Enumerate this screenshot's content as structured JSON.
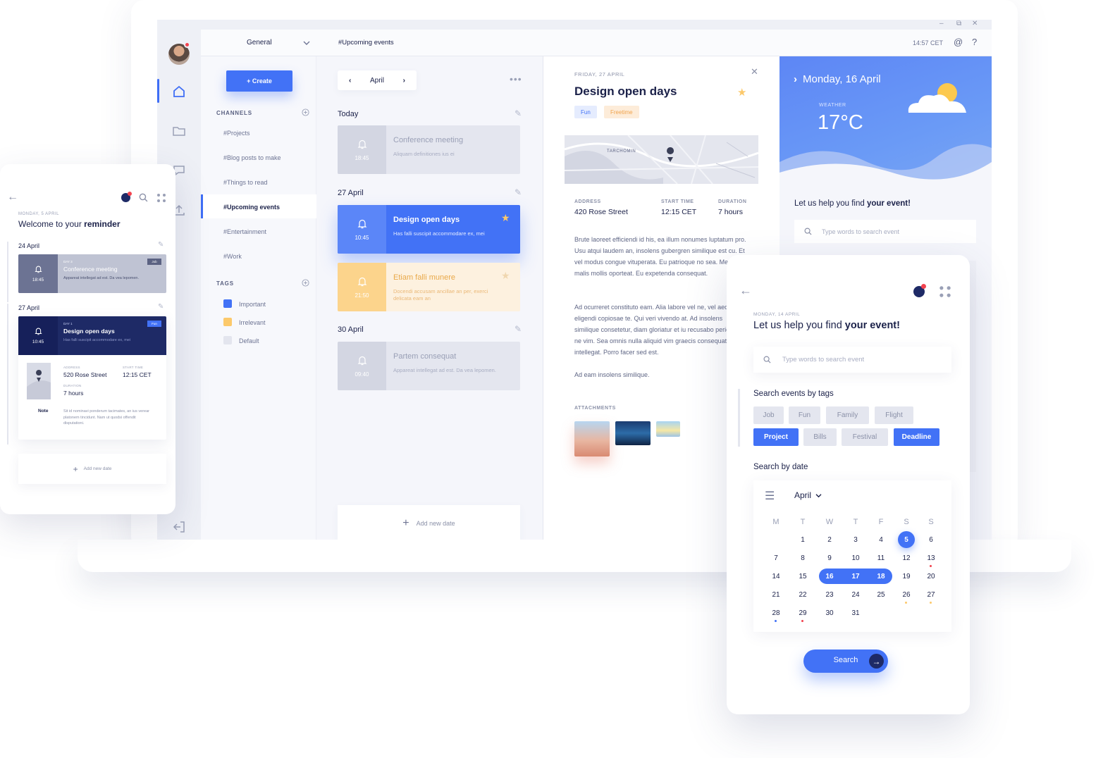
{
  "window": {
    "min": "–",
    "restore": "⧉",
    "close": "✕",
    "clock": "14:57 CET",
    "at": "@",
    "help": "?"
  },
  "sidebar": {
    "workspace": "General",
    "create_label": "+ Create",
    "channels_title": "CHANNELS",
    "channels": [
      "#Projects",
      "#Blog posts to make",
      "#Things to read",
      "#Upcoming events",
      "#Entertainment",
      "#Work"
    ],
    "tags_title": "TAGS",
    "tags": [
      {
        "label": "Important",
        "color": "#4272f6"
      },
      {
        "label": "Irrelevant",
        "color": "#fcc96b"
      },
      {
        "label": "Default",
        "color": "#e3e5ee"
      }
    ]
  },
  "header": {
    "title": "#Upcoming events"
  },
  "events": {
    "month": "April",
    "groups": [
      {
        "day": "Today"
      },
      {
        "day": "27 April"
      },
      {
        "day": "30 April"
      }
    ],
    "cards": [
      {
        "time": "18:45",
        "title": "Conference meeting",
        "desc": "Aliquam definitiones ius ei"
      },
      {
        "time": "10:45",
        "title": "Design open days",
        "desc": "Has falli suscipit accommodare ex, mei"
      },
      {
        "time": "21:50",
        "title": "Etiam falli munere",
        "desc": "Docendi accusam ancillae an per, exerci delicata eam an"
      },
      {
        "time": "09:40",
        "title": "Partem consequat",
        "desc": "Appareat intellegat ad est. Da vea lepomen."
      }
    ],
    "add_date": "Add new date"
  },
  "detail": {
    "date": "FRIDAY, 27 APRIL",
    "title": "Design open days",
    "chips": [
      "Fun",
      "Freetime"
    ],
    "map_label": "TARCHOMIN",
    "address_label": "ADDRESS",
    "address": "420 Rose Street",
    "start_label": "START TIME",
    "start": "12:15 CET",
    "duration_label": "DURATION",
    "duration": "7 hours",
    "p1": "Brute laoreet efficiendi id his, ea illum nonumes luptatum pro. Usu atqui laudem an, insolens gubergren similique est cu. Et vel modus congue vituperata. Eu patrioque no sea. Mea ex malis mollis oporteat. Eu expetenda consequat.",
    "p2": "Ad ocurreret constituto eam. Alia labore vel ne, vel aeque eligendi copiosae te. Qui veri vivendo at. Ad insolens similique consetetur, diam gloriatur et iu recusabo periculis ne vim. Sea omnis nulla aliquid vim graecis consequat intellegat. Porro facer sed est.",
    "p3": "Ad eam insolens similique.",
    "attachments_label": "ATTACHMENTS"
  },
  "weather": {
    "day": "Monday, 16 April",
    "label": "WEATHER",
    "temp": "17°C",
    "help": "Let us help you find ",
    "help_bold": "your event!",
    "search_placeholder": "Type words to search event"
  },
  "phone_left": {
    "date": "MONDAY, 5 APRIL",
    "welcome": "Welcome to your ",
    "welcome_bold": "reminder",
    "group1": "24 April",
    "group2": "27 April",
    "card1": {
      "time": "18:45",
      "day": "DAY 3",
      "title": "Conference meeting",
      "badge": "Job",
      "desc": "Appareat intellegat ad est. Da vea lepomen."
    },
    "card2": {
      "time": "10:45",
      "day": "DAY 1",
      "title": "Design open days",
      "badge": "Fun",
      "desc": "Has falli suscipit accommodare ex, mei"
    },
    "address_label": "ADDRESS",
    "address": "520 Rose Street",
    "start_label": "START TIME",
    "start": "12:15 CET",
    "duration_label": "DURATION",
    "duration": "7 hours",
    "note_label": "Note",
    "note": "Sit id nominavi ponderum tacimates, an ius verear platonem tincidunt. Nam ut quodsi offendit disputationi.",
    "add_date": "Add new date"
  },
  "phone_right": {
    "date": "MONDAY, 14 APRIL",
    "title": "Let us help you find ",
    "title_bold": "your event!",
    "search_placeholder": "Type words to search event",
    "tags_title": "Search events by tags",
    "tags": [
      {
        "label": "Job",
        "active": false
      },
      {
        "label": "Fun",
        "active": false
      },
      {
        "label": "Family",
        "active": false
      },
      {
        "label": "Flight",
        "active": false
      },
      {
        "label": "Project",
        "active": true
      },
      {
        "label": "Bills",
        "active": false
      },
      {
        "label": "Festival",
        "active": false
      },
      {
        "label": "Deadline",
        "active": true
      }
    ],
    "date_title": "Search by date",
    "cal_month": "April",
    "dow": [
      "M",
      "T",
      "W",
      "T",
      "F",
      "S",
      "S"
    ],
    "search_btn": "Search"
  },
  "colors": {
    "accent": "#4272f6",
    "navy": "#1e2a66",
    "yellow": "#fcc96b",
    "text": "#1b2149"
  }
}
